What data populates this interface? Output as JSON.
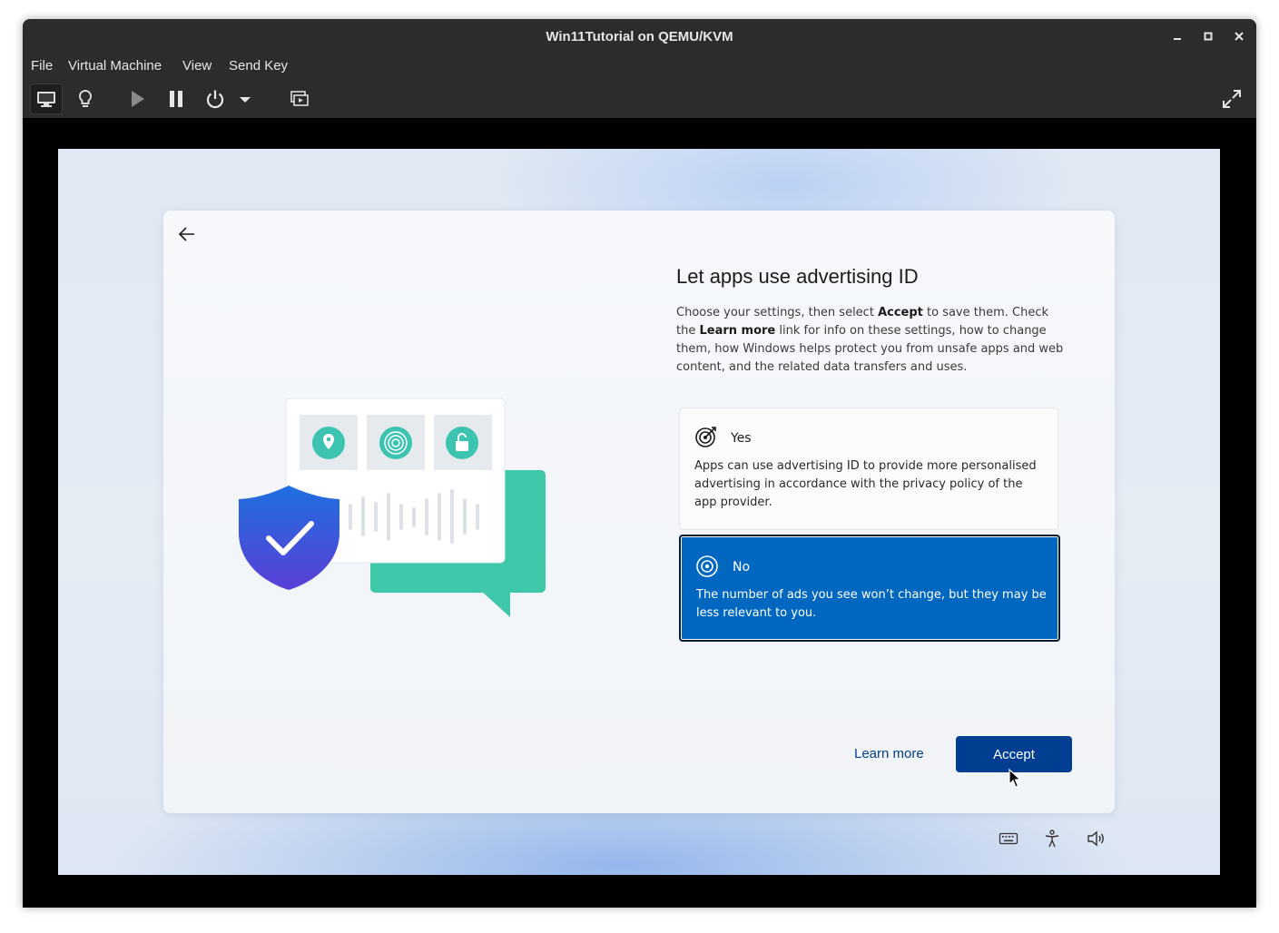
{
  "window": {
    "title": "Win11Tutorial on QEMU/KVM",
    "controls": [
      "minimize-icon",
      "maximize-icon",
      "close-icon"
    ]
  },
  "menu": [
    "File",
    "Virtual Machine",
    "View",
    "Send Key"
  ],
  "toolbar": {
    "buttons": [
      "console-icon",
      "lightbulb-icon",
      "play-icon",
      "pause-icon",
      "power-icon",
      "dropdown-arrow-icon",
      "snapshots-icon",
      "fullscreen-icon"
    ]
  },
  "oobe": {
    "heading": "Let apps use advertising ID",
    "description": {
      "part1": "Choose your settings, then select ",
      "bold1": "Accept",
      "part2": " to save them. Check the ",
      "bold2": "Learn more",
      "part3": " link for info on these settings, how to change them, how Windows helps protect you from unsafe apps and web content, and the related data transfers and uses."
    },
    "options": [
      {
        "title": "Yes",
        "text": "Apps can use advertising ID to provide more personalised advertising in accordance with the privacy policy of the app provider.",
        "selected": false
      },
      {
        "title": "No",
        "text": "The number of ads you see won’t change, but they may be less relevant to you.",
        "selected": true
      }
    ],
    "learn_more": "Learn more",
    "accept": "Accept"
  },
  "guest_tray": [
    "keyboard-icon",
    "accessibility-icon",
    "volume-icon"
  ],
  "colors": {
    "accent": "#0067c0",
    "accept_button": "#003e92",
    "titlebar": "#2c2c2c"
  }
}
